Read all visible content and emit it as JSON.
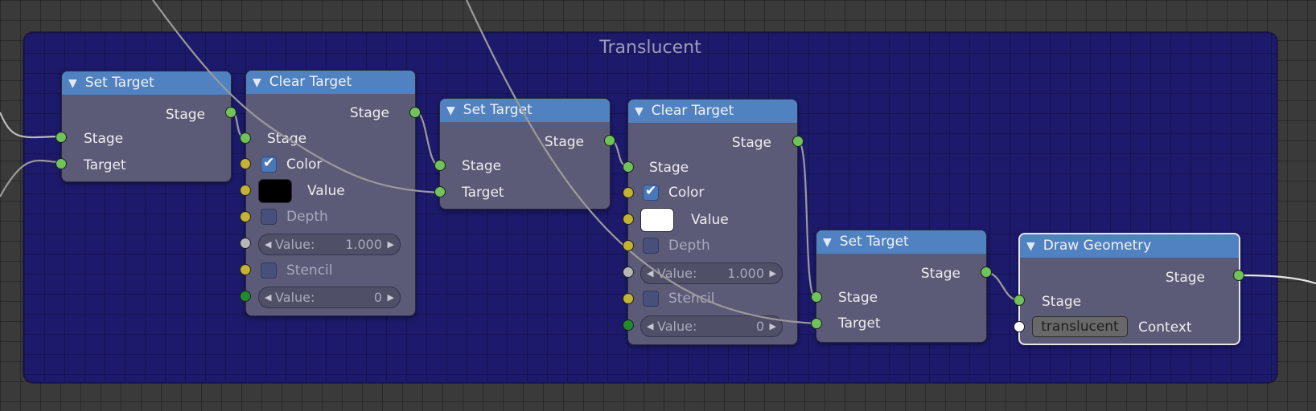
{
  "frame": {
    "title": "Translucent",
    "color": "#1d1a6b"
  },
  "colors": {
    "socket_stage": "#6fc35a",
    "socket_yellow": "#c3b234",
    "socket_gray": "#b7b7b7",
    "socket_darkgreen": "#1f8a2e",
    "socket_white": "#ffffff",
    "header": "#5082c1"
  },
  "nodes": {
    "set_target_1": {
      "title": "Set Target",
      "output": "Stage",
      "inputs": [
        "Stage",
        "Target"
      ]
    },
    "clear_target_1": {
      "title": "Clear Target",
      "output": "Stage",
      "input_stage": "Stage",
      "color_label": "Color",
      "color_checked": true,
      "color_swatch": "#000000",
      "value_label": "Value",
      "depth_label": "Depth",
      "depth_checked": false,
      "depth_value_label": "Value:",
      "depth_value": "1.000",
      "stencil_label": "Stencil",
      "stencil_checked": false,
      "stencil_value_label": "Value:",
      "stencil_value": "0"
    },
    "set_target_2": {
      "title": "Set Target",
      "output": "Stage",
      "inputs": [
        "Stage",
        "Target"
      ]
    },
    "clear_target_2": {
      "title": "Clear Target",
      "output": "Stage",
      "input_stage": "Stage",
      "color_label": "Color",
      "color_checked": true,
      "color_swatch": "#ffffff",
      "value_label": "Value",
      "depth_label": "Depth",
      "depth_checked": false,
      "depth_value_label": "Value:",
      "depth_value": "1.000",
      "stencil_label": "Stencil",
      "stencil_checked": false,
      "stencil_value_label": "Value:",
      "stencil_value": "0"
    },
    "set_target_3": {
      "title": "Set Target",
      "output": "Stage",
      "inputs": [
        "Stage",
        "Target"
      ]
    },
    "draw_geometry": {
      "title": "Draw Geometry",
      "output": "Stage",
      "input_stage": "Stage",
      "context_value": "translucent",
      "context_label": "Context",
      "selected": true
    }
  }
}
